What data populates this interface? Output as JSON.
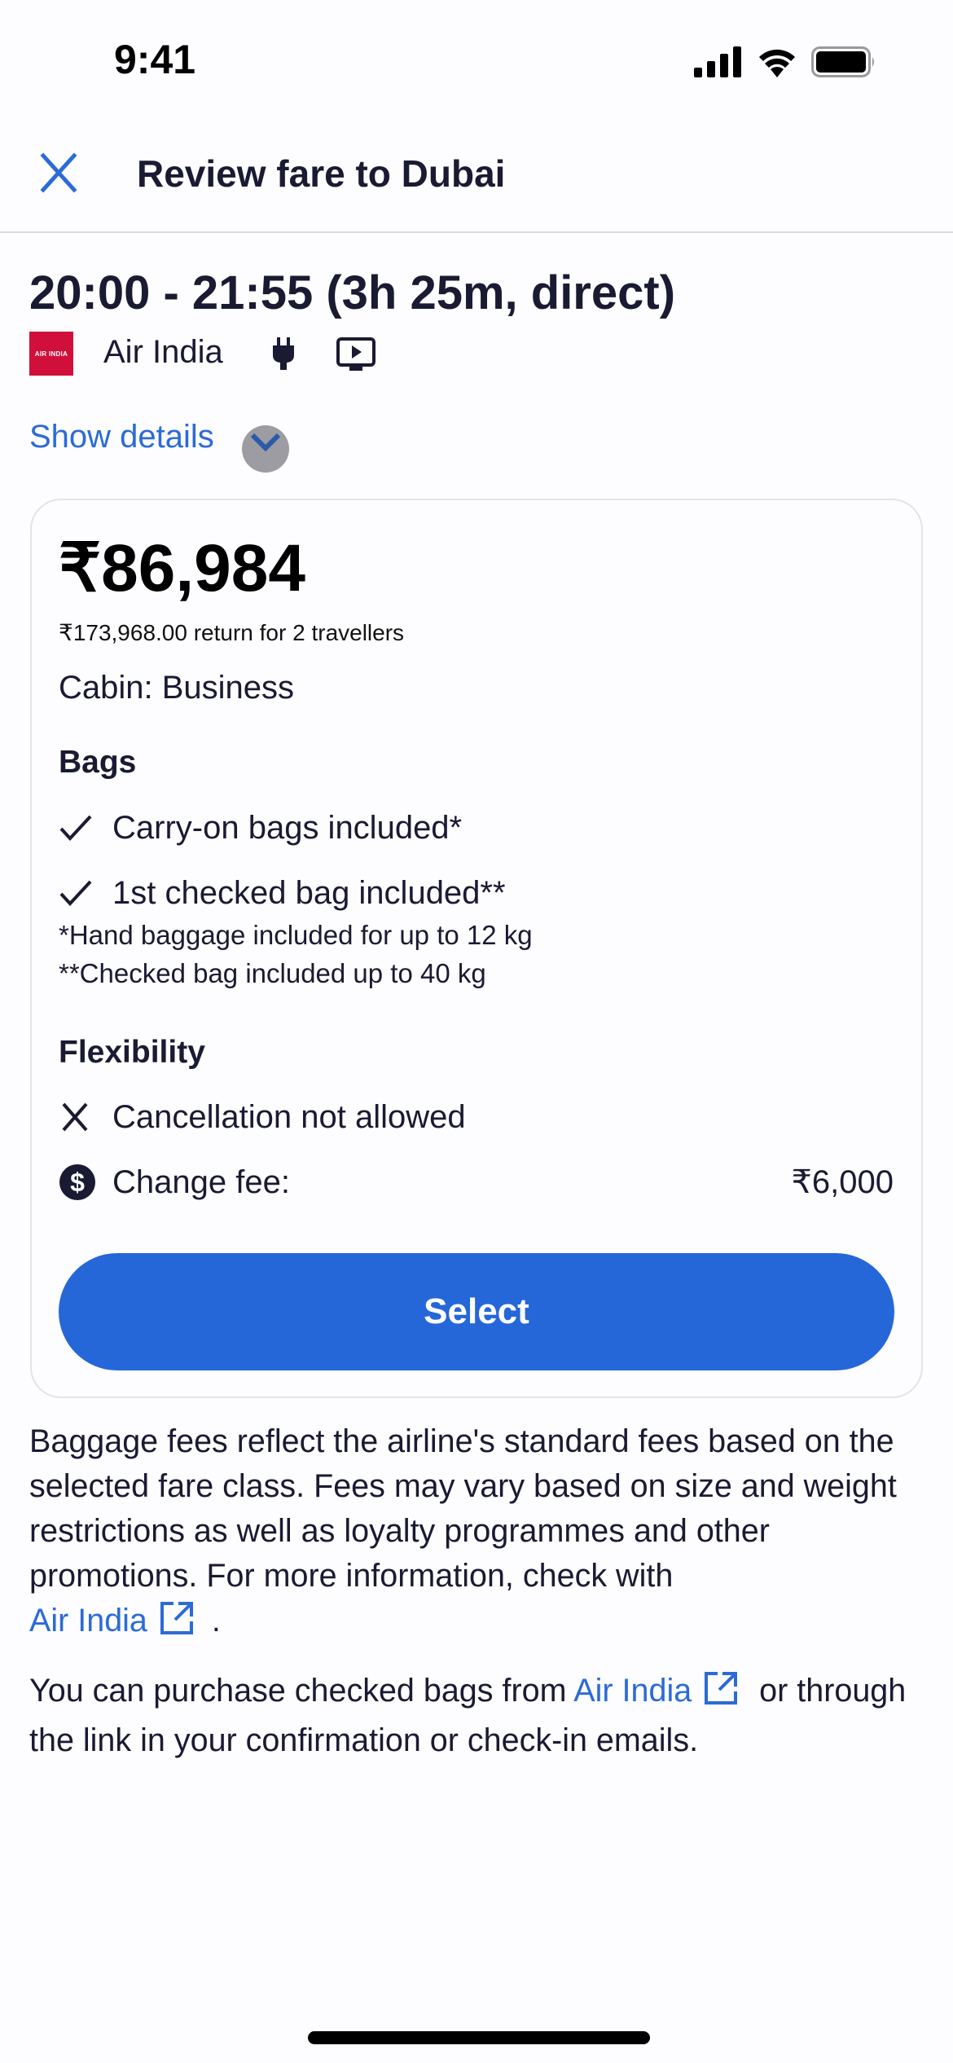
{
  "status_bar": {
    "time": "9:41",
    "icons": [
      "cellular-signal-icon",
      "wifi-icon",
      "battery-icon"
    ]
  },
  "header": {
    "close_icon": "close-icon",
    "title": "Review fare to Dubai"
  },
  "flight": {
    "times": "20:00 - 21:55 (3h 25m, direct)",
    "airline_logo_text": "AIR INDIA",
    "airline": "Air India",
    "amenities": [
      "power-outlet-icon",
      "entertainment-screen-icon"
    ],
    "show_details_label": "Show details"
  },
  "fare_card": {
    "price": "₹86,984",
    "price_subtitle": "₹173,968.00 return for 2 travellers",
    "cabin": "Cabin: Business",
    "bags": {
      "title": "Bags",
      "items": [
        {
          "icon": "checkmark-icon",
          "label": "Carry-on bags included*"
        },
        {
          "icon": "checkmark-icon",
          "label": "1st checked bag included**"
        }
      ],
      "notes": [
        "*Hand baggage included for up to 12 kg",
        "**Checked bag included up to 40 kg"
      ]
    },
    "flexibility": {
      "title": "Flexibility",
      "cancellation": {
        "icon": "cross-icon",
        "label": "Cancellation not allowed"
      },
      "change_fee": {
        "icon": "dollar-circle-icon",
        "label": "Change fee:",
        "value": "₹6,000"
      }
    },
    "select_label": "Select"
  },
  "info": {
    "paragraph1_text": "Baggage fees reflect the airline's standard fees based on the selected fare class. Fees may vary based on size and weight restrictions as well as loyalty programmes and other promotions. For more information, check with",
    "paragraph1_link": "Air India",
    "paragraph1_end": ".",
    "paragraph2_start": "You can purchase checked bags from",
    "paragraph2_link": "Air India",
    "paragraph2_end": "or through the link in your confirmation or check-in emails."
  },
  "colors": {
    "accent": "#2567d8",
    "link": "#2b6bd6",
    "text": "#1a1a33",
    "airline_brand": "#d0103a"
  }
}
